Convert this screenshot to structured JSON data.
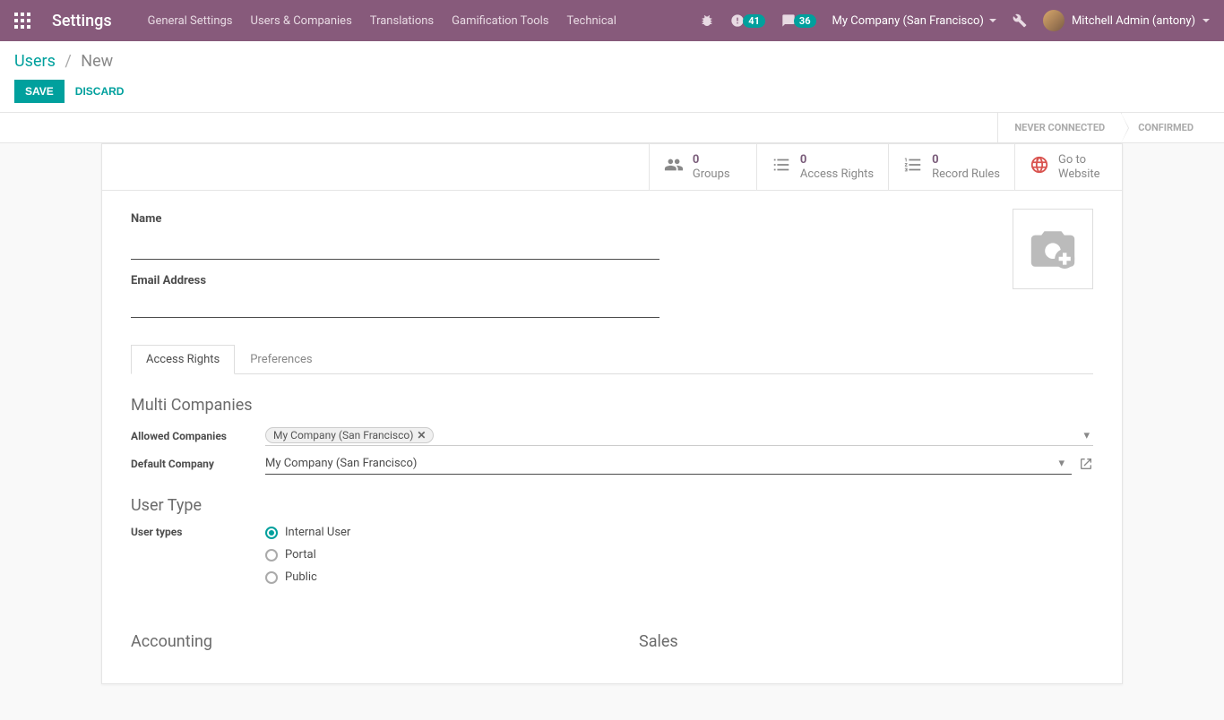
{
  "navbar": {
    "brand": "Settings",
    "menu": [
      "General Settings",
      "Users & Companies",
      "Translations",
      "Gamification Tools",
      "Technical"
    ],
    "activities_count": "41",
    "messages_count": "36",
    "company": "My Company (San Francisco)",
    "user": "Mitchell Admin (antony)"
  },
  "breadcrumb": {
    "parent": "Users",
    "current": "New"
  },
  "buttons": {
    "save": "SAVE",
    "discard": "DISCARD"
  },
  "status": {
    "never_connected": "NEVER CONNECTED",
    "confirmed": "CONFIRMED"
  },
  "stat_buttons": {
    "groups": {
      "value": "0",
      "label": "Groups"
    },
    "access_rights": {
      "value": "0",
      "label": "Access Rights"
    },
    "record_rules": {
      "value": "0",
      "label": "Record Rules"
    },
    "website": {
      "label1": "Go to",
      "label2": "Website"
    }
  },
  "fields": {
    "name_label": "Name",
    "name_value": "",
    "email_label": "Email Address",
    "email_value": ""
  },
  "tabs": {
    "access_rights": "Access Rights",
    "preferences": "Preferences"
  },
  "sections": {
    "multi_companies": {
      "title": "Multi Companies",
      "allowed_label": "Allowed Companies",
      "allowed_tag": "My Company (San Francisco)",
      "default_label": "Default Company",
      "default_value": "My Company (San Francisco)"
    },
    "user_type": {
      "title": "User Type",
      "label": "User types",
      "options": {
        "internal": "Internal User",
        "portal": "Portal",
        "public": "Public"
      }
    },
    "accounting": {
      "title": "Accounting"
    },
    "sales": {
      "title": "Sales"
    }
  }
}
